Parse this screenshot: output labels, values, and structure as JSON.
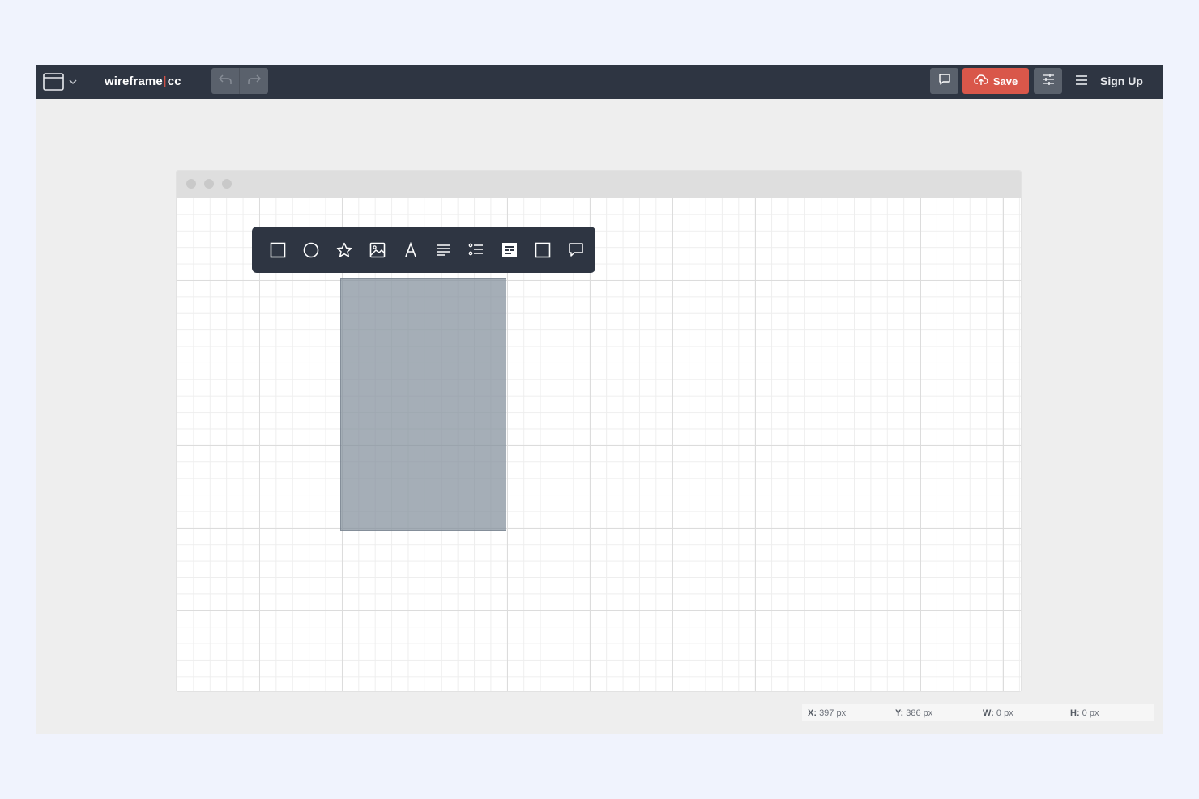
{
  "app": {
    "logo_main": "wireframe",
    "logo_sep": "|",
    "logo_suffix": "cc"
  },
  "topbar": {
    "window_menu_icon": "browser-window-icon",
    "undo_icon": "undo-icon",
    "redo_icon": "redo-icon",
    "comment_icon": "comment-icon",
    "save_label": "Save",
    "save_icon": "cloud-upload-icon",
    "settings_icon": "sliders-icon",
    "menu_icon": "hamburger-icon",
    "signup_label": "Sign Up"
  },
  "shape_toolbar": {
    "tools": [
      {
        "name": "rectangle",
        "icon": "square-icon"
      },
      {
        "name": "circle",
        "icon": "circle-icon"
      },
      {
        "name": "star",
        "icon": "star-icon"
      },
      {
        "name": "image",
        "icon": "image-icon"
      },
      {
        "name": "text",
        "icon": "text-icon"
      },
      {
        "name": "paragraph",
        "icon": "align-left-icon"
      },
      {
        "name": "list",
        "icon": "list-icon"
      },
      {
        "name": "browser",
        "icon": "browser-block-icon"
      },
      {
        "name": "box",
        "icon": "box-icon"
      },
      {
        "name": "callout",
        "icon": "speech-bubble-icon"
      }
    ]
  },
  "status": {
    "x_label": "X:",
    "x_value": "397 px",
    "y_label": "Y:",
    "y_value": "386 px",
    "w_label": "W:",
    "w_value": "0 px",
    "h_label": "H:",
    "h_value": "0 px"
  },
  "colors": {
    "topbar": "#2e3542",
    "save_button": "#d9574a",
    "canvas_shape": "#8e99a6",
    "page_background": "#f0f3fd"
  }
}
